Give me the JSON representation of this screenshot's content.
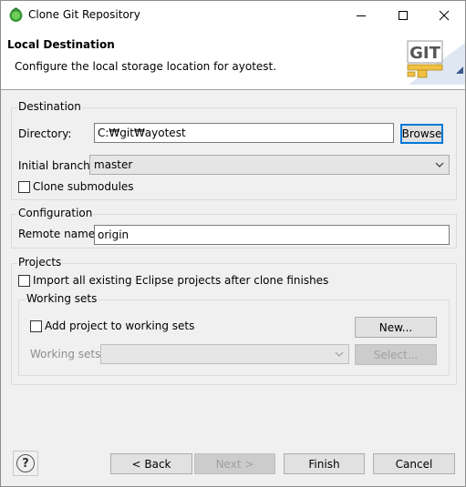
{
  "window": {
    "title": "Clone Git Repository",
    "minimize_glyph": "—",
    "maximize_glyph": "☐",
    "close_glyph": "✕"
  },
  "header": {
    "title": "Local Destination",
    "description": "Configure the local storage location for ayotest.",
    "logo_text": "GIT"
  },
  "destination": {
    "group_label": "Destination",
    "directory_label": "Directory:",
    "directory_value": "C:₩git₩ayotest",
    "browse_label": "Browse",
    "initial_branch_label": "Initial branch:",
    "initial_branch_value": "master",
    "clone_submodules_label": "Clone submodules",
    "clone_submodules_checked": false
  },
  "configuration": {
    "group_label": "Configuration",
    "remote_name_label": "Remote name:",
    "remote_name_value": "origin"
  },
  "projects": {
    "group_label": "Projects",
    "import_label": "Import all existing Eclipse projects after clone finishes",
    "import_checked": false,
    "working_sets": {
      "group_label": "Working sets",
      "add_label": "Add project to working sets",
      "add_checked": false,
      "new_button": "New...",
      "working_sets_label": "Working sets:",
      "working_sets_value": "",
      "select_button": "Select..."
    }
  },
  "footer": {
    "help_glyph": "?",
    "back_label": "< Back",
    "next_label": "Next >",
    "finish_label": "Finish",
    "cancel_label": "Cancel"
  },
  "colors": {
    "focus": "#0078d7",
    "disabled_text": "#8d8d8d"
  }
}
